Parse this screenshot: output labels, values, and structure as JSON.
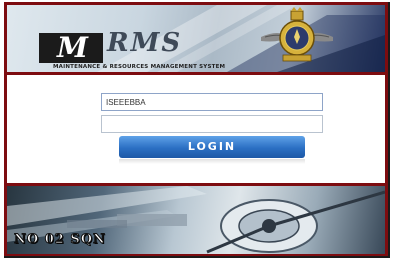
{
  "logo": {
    "mark": "M",
    "rest": "RMS",
    "subtitle": "MAINTENANCE & RESOURCES MANAGEMENT SYSTEM"
  },
  "login": {
    "username_value": "ISEEEBBA",
    "password_value": "",
    "button_label": "LOGIN"
  },
  "footer": {
    "unit_label": "NO 02 SQN"
  },
  "colors": {
    "frame": "#7d0c10",
    "button": "#2b6fc3",
    "input_border": "#8ea4c8"
  },
  "icons": {
    "emblem": "squadron-crest-icon"
  }
}
